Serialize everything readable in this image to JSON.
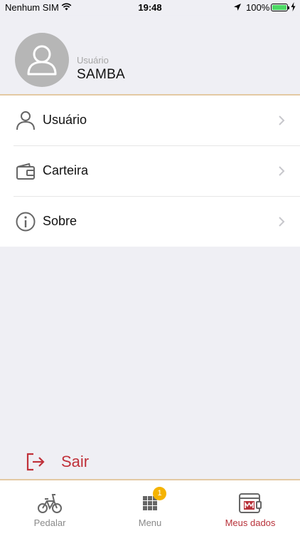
{
  "status_bar": {
    "carrier": "Nenhum SIM",
    "time": "19:48",
    "battery": "100%",
    "icons": [
      "wifi-icon",
      "location-arrow-icon",
      "battery-icon",
      "charging-bolt-icon"
    ]
  },
  "profile": {
    "caption": "Usuário",
    "name": "SAMBA",
    "avatar_icon": "user-silhouette-icon"
  },
  "menu": {
    "items": [
      {
        "label": "Usuário",
        "icon": "user-icon"
      },
      {
        "label": "Carteira",
        "icon": "wallet-icon"
      },
      {
        "label": "Sobre",
        "icon": "info-icon"
      }
    ]
  },
  "logout": {
    "label": "Sair",
    "icon": "logout-icon"
  },
  "tabs": [
    {
      "label": "Pedalar",
      "icon": "bicycle-icon"
    },
    {
      "label": "Menu",
      "icon": "grid-icon",
      "badge": "1"
    },
    {
      "label": "Meus dados",
      "icon": "wallet-m-icon",
      "active": true
    }
  ],
  "colors": {
    "accent_red": "#b8323a",
    "badge_yellow": "#f5b301",
    "divider_gold": "#e3c9a3",
    "background": "#efeff4"
  }
}
